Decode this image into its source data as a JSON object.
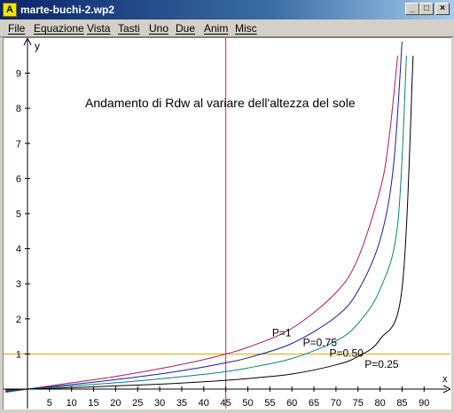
{
  "window": {
    "title": "marte-buchi-2.wp2",
    "icon": "app-logo-icon",
    "buttons": {
      "minimize": "_",
      "maximize": "□",
      "close": "×"
    }
  },
  "menu": {
    "file": "File",
    "equazione": "Equazione",
    "vista": "Vista",
    "tasti": "Tasti",
    "uno": "Uno",
    "due": "Due",
    "anim": "Anim",
    "misc": "Misc"
  },
  "chart_data": {
    "type": "line",
    "title": "Andamento di Rdw al variare dell'altezza del sole",
    "xlabel": "x",
    "ylabel": "y",
    "xlim": [
      -5,
      90
    ],
    "ylim": [
      -0.5,
      9.9
    ],
    "x_ticks": [
      "5",
      "10",
      "15",
      "20",
      "25",
      "30",
      "35",
      "40",
      "45",
      "50",
      "55",
      "60",
      "65",
      "70",
      "75",
      "80",
      "85",
      "90"
    ],
    "y_ticks": [
      "1",
      "2",
      "3",
      "4",
      "5",
      "6",
      "7",
      "8",
      "9"
    ],
    "vertical_line": {
      "x": 45,
      "color": "#c0392b"
    },
    "horizontal_line": {
      "y": 1,
      "color": "#e0a000"
    },
    "series": [
      {
        "name": "P=1",
        "color": "#b0185a",
        "x": [
          -5,
          0,
          10,
          20,
          30,
          40,
          45,
          50,
          60,
          70,
          75,
          80,
          82,
          84
        ],
        "y": [
          -0.09,
          0,
          0.18,
          0.36,
          0.58,
          0.84,
          1.0,
          1.19,
          1.73,
          2.75,
          3.73,
          5.67,
          7.1,
          9.5
        ]
      },
      {
        "name": "P=0.75",
        "color": "#1a1aa0",
        "x": [
          -5,
          0,
          10,
          20,
          30,
          40,
          45,
          50,
          60,
          70,
          75,
          80,
          83,
          85
        ],
        "y": [
          -0.07,
          0,
          0.13,
          0.27,
          0.43,
          0.63,
          0.75,
          0.89,
          1.3,
          2.06,
          2.8,
          4.25,
          6.3,
          9.9
        ]
      },
      {
        "name": "P=0.50",
        "color": "#0a7f7f",
        "x": [
          -5,
          0,
          10,
          20,
          30,
          40,
          45,
          50,
          60,
          70,
          75,
          80,
          84,
          86
        ],
        "y": [
          -0.04,
          0,
          0.09,
          0.18,
          0.29,
          0.42,
          0.5,
          0.6,
          0.87,
          1.37,
          1.87,
          2.84,
          4.7,
          9.5
        ]
      },
      {
        "name": "P=0.25",
        "color": "#000000",
        "x": [
          -5,
          0,
          10,
          20,
          30,
          40,
          45,
          50,
          60,
          70,
          75,
          80,
          85,
          87.5
        ],
        "y": [
          -0.02,
          0,
          0.04,
          0.09,
          0.14,
          0.21,
          0.25,
          0.3,
          0.43,
          0.69,
          0.93,
          1.42,
          2.86,
          9.5
        ]
      }
    ],
    "series_labels": [
      {
        "text": "P=1",
        "x": 55.5,
        "y": 1.5
      },
      {
        "text": "P=0.75",
        "x": 62.5,
        "y": 1.22
      },
      {
        "text": "P=0.50",
        "x": 68.5,
        "y": 0.92
      },
      {
        "text": "P=0.25",
        "x": 76.5,
        "y": 0.6
      }
    ]
  }
}
